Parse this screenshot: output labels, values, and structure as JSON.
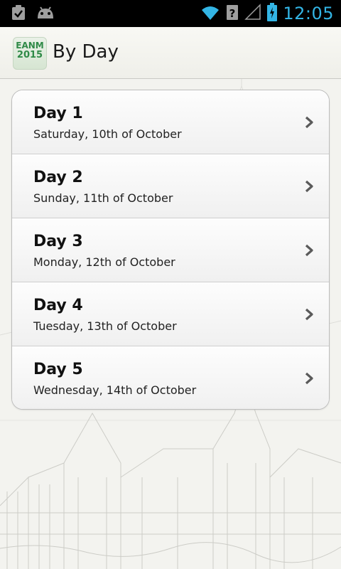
{
  "status_bar": {
    "time": "12:05",
    "icons": [
      "clipboard-icon",
      "android-icon",
      "wifi-icon",
      "unknown-sim-icon",
      "signal-icon",
      "battery-charging-icon"
    ],
    "accent_color": "#33b5e5"
  },
  "action_bar": {
    "logo_line1": "EANM",
    "logo_line2": "2015",
    "title": "By Day"
  },
  "days": [
    {
      "title": "Day 1",
      "subtitle": "Saturday, 10th of October"
    },
    {
      "title": "Day 2",
      "subtitle": "Sunday, 11th of October"
    },
    {
      "title": "Day 3",
      "subtitle": "Monday, 12th of October"
    },
    {
      "title": "Day 4",
      "subtitle": "Tuesday, 13th of October"
    },
    {
      "title": "Day 5",
      "subtitle": "Wednesday, 14th of October"
    }
  ]
}
